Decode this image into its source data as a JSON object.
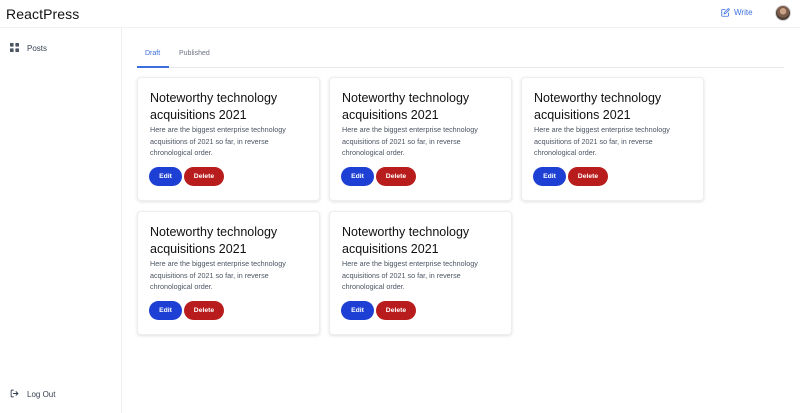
{
  "app": {
    "brand": "ReactPress"
  },
  "header": {
    "write_label": "Write",
    "write_icon": "pencil-square-icon"
  },
  "sidebar": {
    "posts_label": "Posts",
    "posts_icon": "grid-icon",
    "logout_label": "Log Out",
    "logout_icon": "logout-arrow-icon"
  },
  "tabs": [
    {
      "label": "Draft",
      "active": true
    },
    {
      "label": "Published",
      "active": false
    }
  ],
  "posts": [
    {
      "title": "Noteworthy technology acquisitions 2021",
      "description": "Here are the biggest enterprise technology acquisitions of 2021 so far, in reverse chronological order.",
      "edit_label": "Edit",
      "delete_label": "Delete"
    },
    {
      "title": "Noteworthy technology acquisitions 2021",
      "description": "Here are the biggest enterprise technology acquisitions of 2021 so far, in reverse chronological order.",
      "edit_label": "Edit",
      "delete_label": "Delete"
    },
    {
      "title": "Noteworthy technology acquisitions 2021",
      "description": "Here are the biggest enterprise technology acquisitions of 2021 so far, in reverse chronological order.",
      "edit_label": "Edit",
      "delete_label": "Delete"
    },
    {
      "title": "Noteworthy technology acquisitions 2021",
      "description": "Here are the biggest enterprise technology acquisitions of 2021 so far, in reverse chronological order.",
      "edit_label": "Edit",
      "delete_label": "Delete"
    },
    {
      "title": "Noteworthy technology acquisitions 2021",
      "description": "Here are the biggest enterprise technology acquisitions of 2021 so far, in reverse chronological order.",
      "edit_label": "Edit",
      "delete_label": "Delete"
    }
  ],
  "colors": {
    "accent": "#3b6fe0",
    "edit_button": "#1d3fd4",
    "delete_button": "#b91c1c"
  }
}
